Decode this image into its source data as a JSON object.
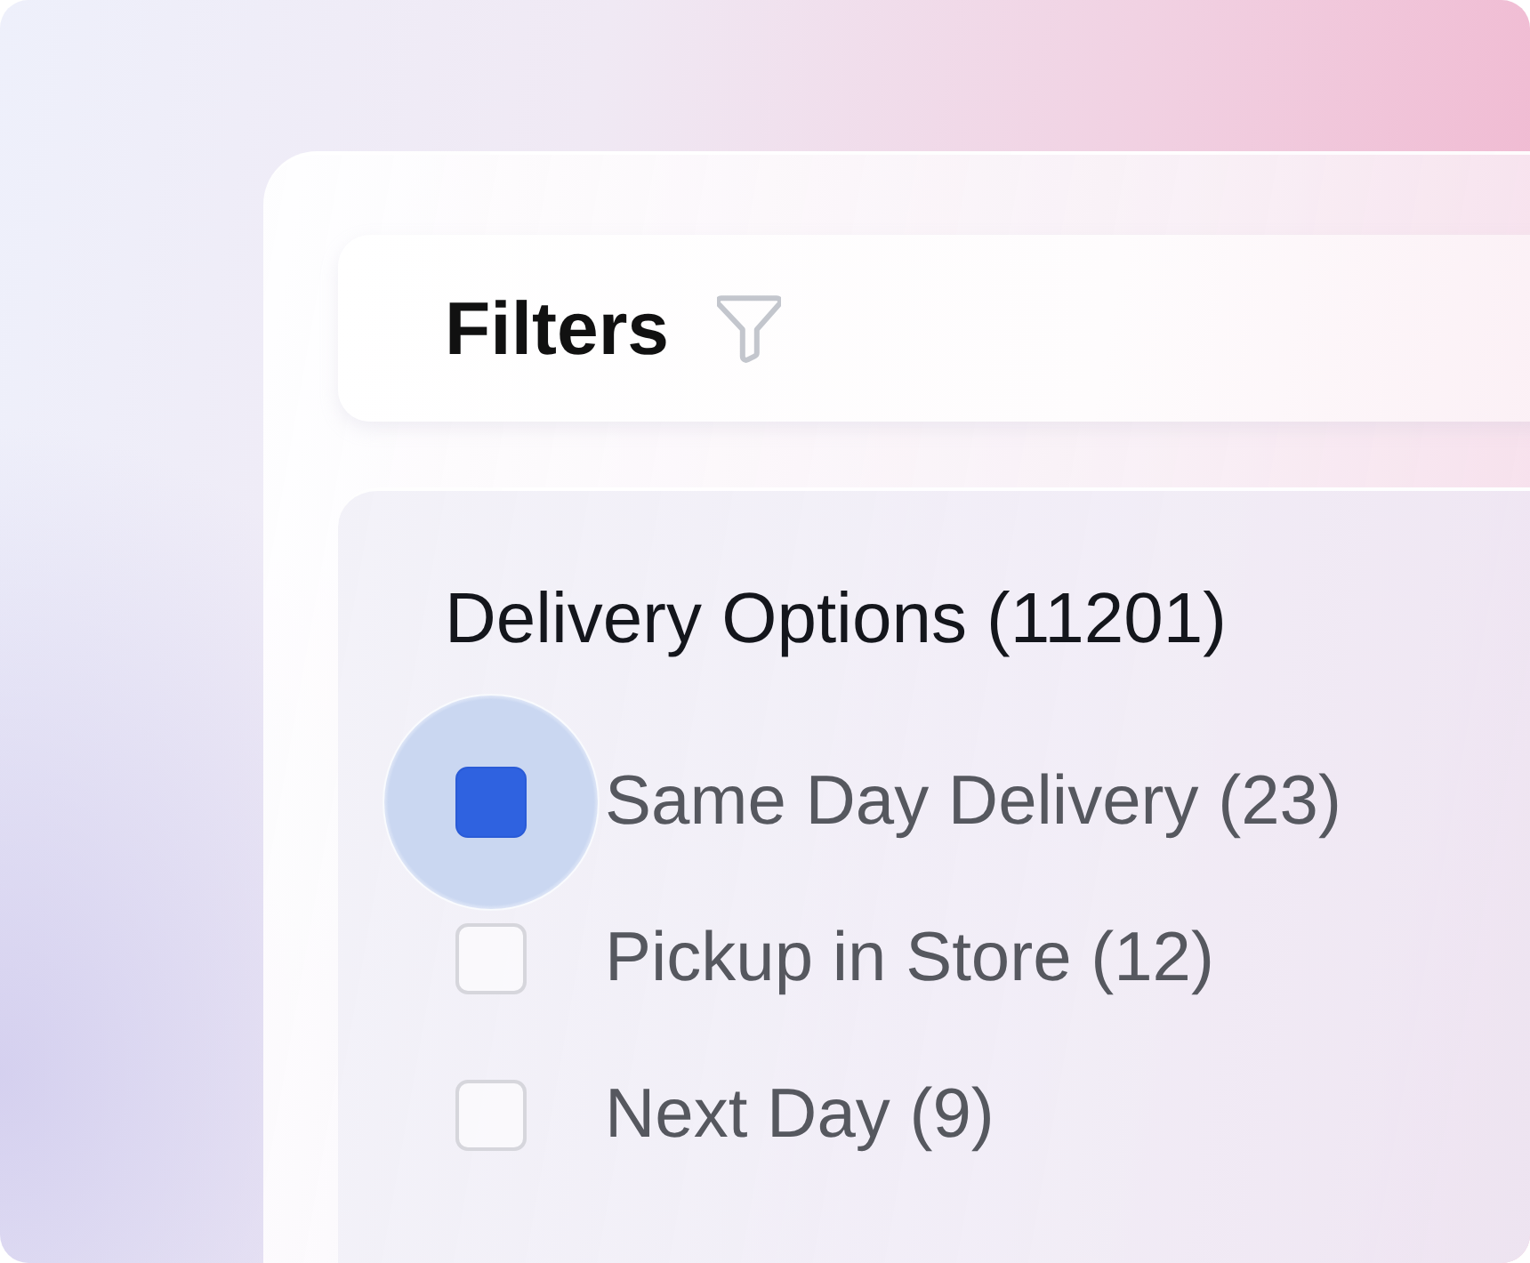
{
  "header": {
    "title": "Filters"
  },
  "section": {
    "title": "Delivery Options (11201)",
    "options": [
      {
        "label": "Same Day Delivery (23)",
        "checked": true
      },
      {
        "label": "Pickup in Store (12)",
        "checked": false
      },
      {
        "label": "Next Day (9)",
        "checked": false
      }
    ]
  }
}
